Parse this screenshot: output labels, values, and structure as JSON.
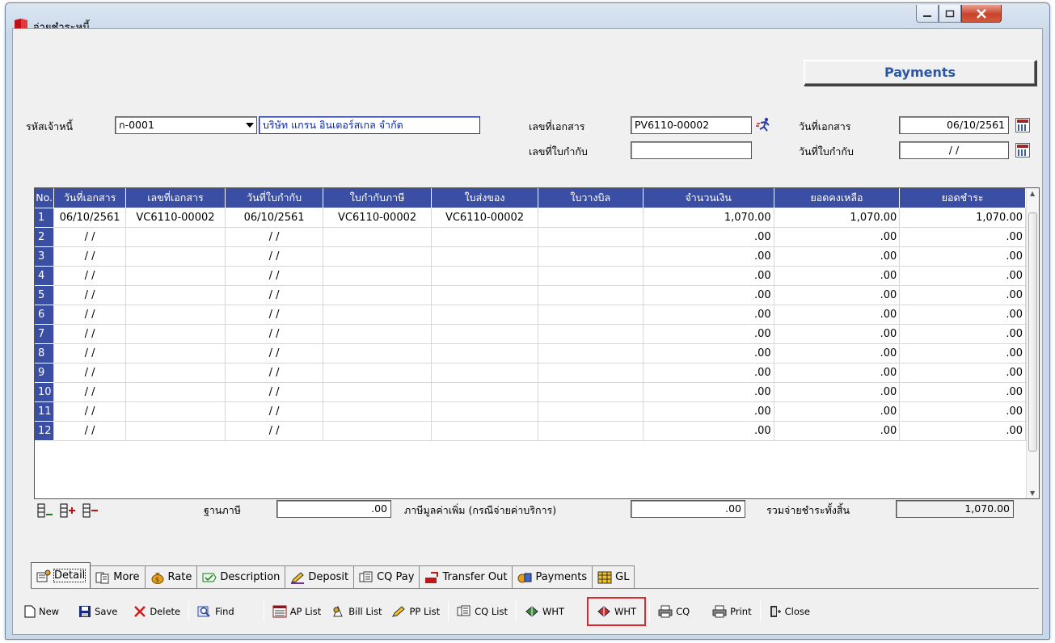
{
  "window": {
    "title": "จ่ายชำระหนี้"
  },
  "header": {
    "badge": "Payments"
  },
  "form": {
    "creditor_code_label": "รหัสเจ้าหนี้",
    "creditor_code": "ก-0001",
    "creditor_name": "บริษัท แกรน อินเตอร์สเกล จำกัด",
    "doc_no_label": "เลขที่เอกสาร",
    "doc_no": "PV6110-00002",
    "tax_inv_no_label": "เลขที่ใบกำกับ",
    "tax_inv_no": "",
    "doc_date_label": "วันที่เอกสาร",
    "doc_date": "06/10/2561",
    "tax_inv_date_label": "วันที่ใบกำกับ",
    "tax_inv_date": "/ /"
  },
  "grid": {
    "columns": [
      "No.",
      "วันที่เอกสาร",
      "เลขที่เอกสาร",
      "วันที่ใบกำกับ",
      "ใบกำกับภาษี",
      "ใบส่งของ",
      "ใบวางบิล",
      "จำนวนเงิน",
      "ยอดคงเหลือ",
      "ยอดชำระ"
    ],
    "rows": [
      [
        "1",
        "06/10/2561",
        "VC6110-00002",
        "06/10/2561",
        "VC6110-00002",
        "VC6110-00002",
        "",
        "1,070.00",
        "1,070.00",
        "1,070.00"
      ],
      [
        "2",
        "/ /",
        "",
        "/ /",
        "",
        "",
        "",
        ".00",
        ".00",
        ".00"
      ],
      [
        "3",
        "/ /",
        "",
        "/ /",
        "",
        "",
        "",
        ".00",
        ".00",
        ".00"
      ],
      [
        "4",
        "/ /",
        "",
        "/ /",
        "",
        "",
        "",
        ".00",
        ".00",
        ".00"
      ],
      [
        "5",
        "/ /",
        "",
        "/ /",
        "",
        "",
        "",
        ".00",
        ".00",
        ".00"
      ],
      [
        "6",
        "/ /",
        "",
        "/ /",
        "",
        "",
        "",
        ".00",
        ".00",
        ".00"
      ],
      [
        "7",
        "/ /",
        "",
        "/ /",
        "",
        "",
        "",
        ".00",
        ".00",
        ".00"
      ],
      [
        "8",
        "/ /",
        "",
        "/ /",
        "",
        "",
        "",
        ".00",
        ".00",
        ".00"
      ],
      [
        "9",
        "/ /",
        "",
        "/ /",
        "",
        "",
        "",
        ".00",
        ".00",
        ".00"
      ],
      [
        "10",
        "/ /",
        "",
        "/ /",
        "",
        "",
        "",
        ".00",
        ".00",
        ".00"
      ],
      [
        "11",
        "/ /",
        "",
        "/ /",
        "",
        "",
        "",
        ".00",
        ".00",
        ".00"
      ],
      [
        "12",
        "/ /",
        "",
        "/ /",
        "",
        "",
        "",
        ".00",
        ".00",
        ".00"
      ]
    ]
  },
  "totals": {
    "tax_base_label": "ฐานภาษี",
    "tax_base": ".00",
    "vat_label": "ภาษีมูลค่าเพิ่ม (กรณีจ่ายค่าบริการ)",
    "vat": ".00",
    "grand_total_label": "รวมจ่ายชำระทั้งสิ้น",
    "grand_total": "1,070.00"
  },
  "tabs": [
    "Detail",
    "More",
    "Rate",
    "Description",
    "Deposit",
    "CQ Pay",
    "Transfer Out",
    "Payments",
    "GL"
  ],
  "toolbar": {
    "new": "New",
    "save": "Save",
    "delete": "Delete",
    "find": "Find",
    "ap_list": "AP List",
    "bill_list": "Bill List",
    "pp_list": "PP List",
    "cq_list": "CQ List",
    "wht1": "WHT",
    "wht2": "WHT",
    "cq": "CQ",
    "print": "Print",
    "close": "Close"
  },
  "colors": {
    "grid_header": "#3a4ea3",
    "highlight_box": "#e0262a",
    "header_badge_text": "#2b55a5"
  }
}
